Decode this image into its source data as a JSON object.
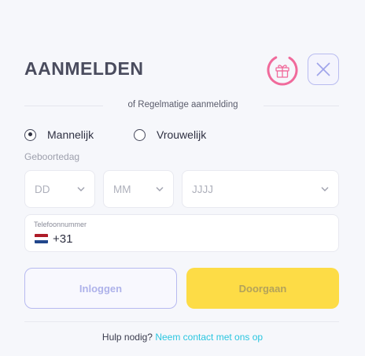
{
  "header": {
    "title": "AANMELDEN"
  },
  "divider": {
    "text": "of Regelmatige aanmelding"
  },
  "gender": {
    "options": [
      {
        "label": "Mannelijk",
        "selected": true
      },
      {
        "label": "Vrouwelijk",
        "selected": false
      }
    ]
  },
  "birthdate": {
    "label": "Geboortedag",
    "day": "DD",
    "month": "MM",
    "year": "JJJJ"
  },
  "phone": {
    "label": "Telefoonnummer",
    "country_code": "+31",
    "flag": "netherlands-flag"
  },
  "actions": {
    "login_label": "Inloggen",
    "continue_label": "Doorgaan"
  },
  "footer": {
    "help_text": "Hulp nodig?",
    "contact_link": "Neem contact met ons op"
  },
  "colors": {
    "accent_yellow": "#fddc46",
    "accent_purple": "#b7baf0",
    "gift_pink": "#f06a9b",
    "link": "#2bc6e0"
  },
  "icons": {
    "gift": "gift-icon",
    "close": "close-icon",
    "dropdown": "chevron-down-icon"
  }
}
